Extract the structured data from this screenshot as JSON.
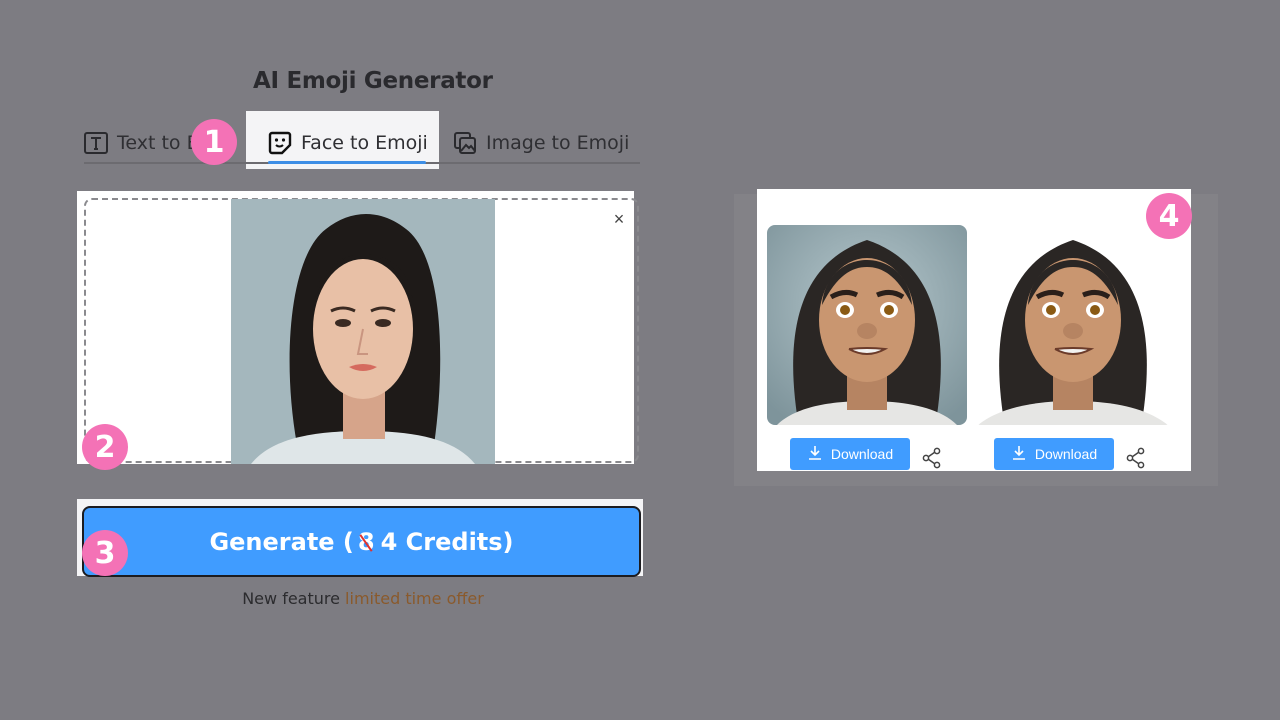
{
  "header": {
    "title": "AI Emoji Generator"
  },
  "tabs": [
    {
      "label": "Text to Emoji",
      "visible_label": "Text to E",
      "icon": "text-icon",
      "active": false
    },
    {
      "label": "Face to Emoji",
      "icon": "face-sticker-icon",
      "active": true
    },
    {
      "label": "Image to Emoji",
      "icon": "images-icon",
      "active": false
    }
  ],
  "badges": [
    "1",
    "2",
    "3",
    "4"
  ],
  "upload": {
    "close_label": "×",
    "image_desc": "Uploaded portrait photo of a woman with long dark hair"
  },
  "generate": {
    "prefix": "Generate (",
    "old_credits": "8",
    "new_credits": "4 Credits)"
  },
  "offer": {
    "text": "New feature",
    "highlight": "limited time offer"
  },
  "results": [
    {
      "desc": "Emoji avatar with background",
      "download_label": "Download"
    },
    {
      "desc": "Emoji avatar transparent background",
      "download_label": "Download"
    }
  ],
  "colors": {
    "accent": "#409cff",
    "badge": "#f472b6",
    "background": "#7d7c82",
    "offer_highlight": "#8a5a2c"
  }
}
